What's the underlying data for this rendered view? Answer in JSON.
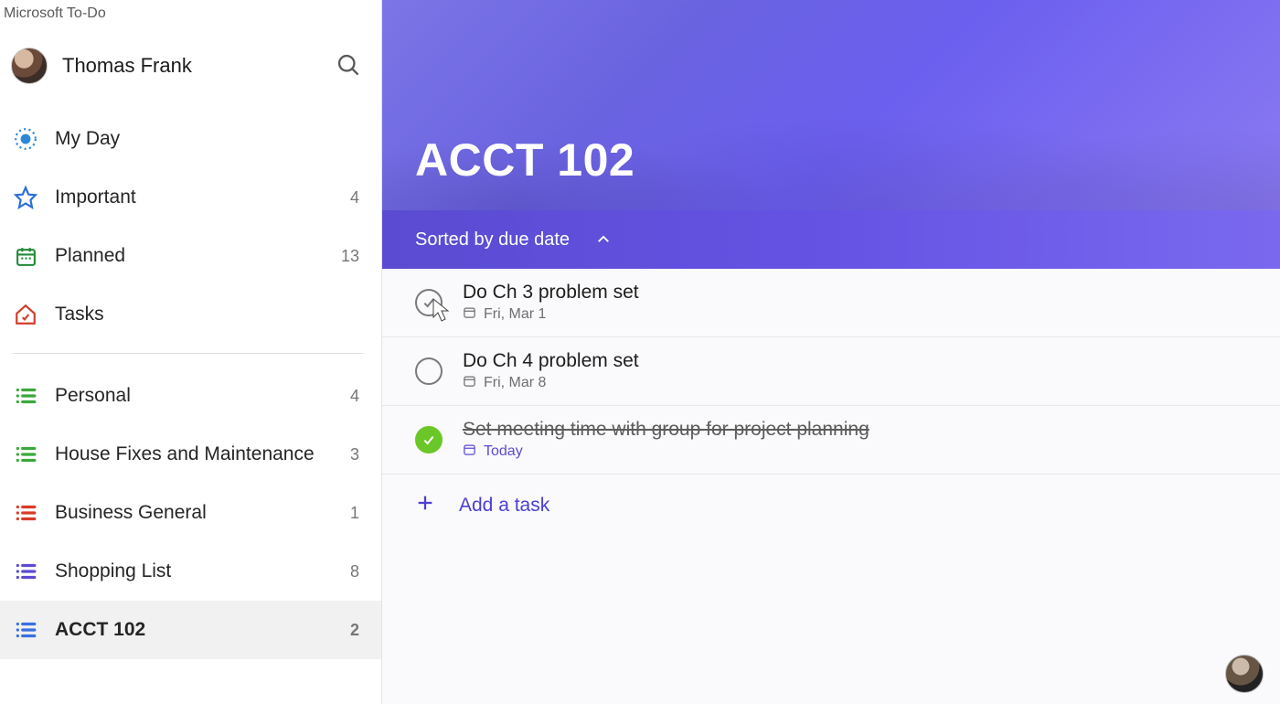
{
  "app": {
    "title": "Microsoft To-Do"
  },
  "user": {
    "name": "Thomas Frank"
  },
  "smartLists": [
    {
      "key": "myday",
      "label": "My Day",
      "count": "",
      "icon": "sun-icon",
      "color": "#2b88d8"
    },
    {
      "key": "important",
      "label": "Important",
      "count": "4",
      "icon": "star-icon",
      "color": "#2b6fd8"
    },
    {
      "key": "planned",
      "label": "Planned",
      "count": "13",
      "icon": "calendar-icon",
      "color": "#1f8a36"
    },
    {
      "key": "tasks",
      "label": "Tasks",
      "count": "",
      "icon": "home-icon",
      "color": "#d13d2a"
    }
  ],
  "customLists": [
    {
      "key": "personal",
      "label": "Personal",
      "count": "4",
      "color": "#3ba83b"
    },
    {
      "key": "house",
      "label": "House Fixes and Maintenance",
      "count": "3",
      "color": "#3ba83b"
    },
    {
      "key": "business",
      "label": "Business General",
      "count": "1",
      "color": "#d83b2a"
    },
    {
      "key": "shopping",
      "label": "Shopping List",
      "count": "8",
      "color": "#5a4bd1"
    },
    {
      "key": "acct102",
      "label": "ACCT 102",
      "count": "2",
      "color": "#3a6fe0",
      "selected": true
    }
  ],
  "main": {
    "title": "ACCT 102",
    "sortLabel": "Sorted by due date",
    "addTaskLabel": "Add a task"
  },
  "tasks": [
    {
      "title": "Do Ch 3 problem set",
      "due": "Fri, Mar 1",
      "dueClass": "",
      "completed": false,
      "hoverCheck": true
    },
    {
      "title": "Do Ch 4 problem set",
      "due": "Fri, Mar 8",
      "dueClass": "",
      "completed": false,
      "hoverCheck": false
    },
    {
      "title": "Set meeting time with group for project planning",
      "due": "Today",
      "dueClass": "today",
      "completed": true,
      "hoverCheck": false
    }
  ]
}
